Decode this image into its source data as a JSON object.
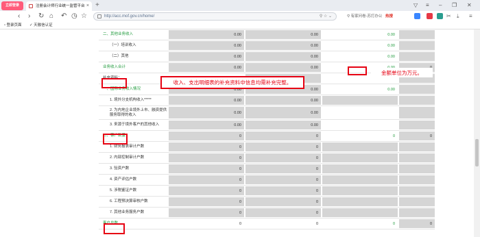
{
  "browser": {
    "logo_label": "立即登录",
    "tab_title": "注册会计师行业统一监管平台",
    "url": "http://acc.mof.gov.cn/home/",
    "search_placeholder": "有家问卷-苏打办公",
    "search_badge": "热搜",
    "bookmarks": [
      "登录页面",
      "天融信认证"
    ]
  },
  "table": {
    "rows": [
      {
        "label": "二、其他业务收入",
        "style": "green",
        "cols": [
          "0.00",
          "0.00",
          "0.00",
          ""
        ]
      },
      {
        "label": "（一）培训收入",
        "style": "indent",
        "cols": [
          "0.00",
          "0.00",
          "0.00",
          ""
        ]
      },
      {
        "label": "（二）其他",
        "style": "indent",
        "cols": [
          "0.00",
          "0.00",
          "0.00",
          ""
        ]
      },
      {
        "label": "业务收入合计",
        "style": "green",
        "cols": [
          "0.00",
          "0.00",
          "0.00",
          "0"
        ]
      },
      {
        "label": "补充资料：",
        "style": "",
        "cols": [
          "",
          "",
          "",
          ""
        ]
      },
      {
        "label": "一、国际业务收入情况",
        "style": "green",
        "cols": [
          "0.00",
          "0.00",
          "0.00",
          ""
        ]
      },
      {
        "label": "1. 境外分支机构收入*****",
        "style": "indent",
        "cols": [
          "0.00",
          "0.00",
          "",
          ""
        ]
      },
      {
        "label": "2. 为内地企业境外上市、融资提供服务取得的收入",
        "style": "indent",
        "cols": [
          "0.00",
          "0.00",
          "",
          ""
        ]
      },
      {
        "label": "3. 来源于境外客户的其他收入",
        "style": "indent",
        "cols": [
          "0.00",
          "0.00",
          "",
          ""
        ]
      },
      {
        "label": "二、客户数量",
        "style": "green",
        "cols": [
          "0",
          "0",
          "0",
          "0"
        ]
      },
      {
        "label": "1. 财务报表审计户数",
        "style": "indent",
        "cols": [
          "0",
          "0",
          "",
          ""
        ]
      },
      {
        "label": "2. 内部控制审计户数",
        "style": "indent",
        "cols": [
          "0",
          "0",
          "",
          ""
        ]
      },
      {
        "label": "3. 验资户数",
        "style": "indent",
        "cols": [
          "0",
          "0",
          "",
          ""
        ]
      },
      {
        "label": "4. 资产评估户数",
        "style": "indent",
        "cols": [
          "0",
          "0",
          "",
          ""
        ]
      },
      {
        "label": "5. 涉税鉴证户数",
        "style": "indent",
        "cols": [
          "0",
          "0",
          "",
          ""
        ]
      },
      {
        "label": "6. 工程预决算审核户数",
        "style": "indent",
        "cols": [
          "0",
          "0",
          "",
          ""
        ]
      },
      {
        "label": "7. 其他业务服务户数",
        "style": "indent",
        "cols": [
          "0",
          "0",
          "",
          ""
        ]
      },
      {
        "label": "客户总数",
        "style": "green",
        "cols": [
          "0",
          "0",
          "0",
          "0"
        ]
      }
    ]
  },
  "annotations": {
    "callout_supplement": "收入、支出明细表的补充资料中信息均需补充完整。",
    "callout_unit": "金额单位为万元。"
  }
}
